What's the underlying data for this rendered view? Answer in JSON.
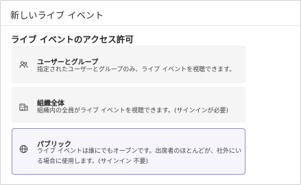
{
  "header": {
    "title": "新しいライブ イベント"
  },
  "section": {
    "title": "ライブ イベントのアクセス許可"
  },
  "options": [
    {
      "title": "ユーザーとグループ",
      "description": "指定されたユーザーとグループのみ、ライブ イベントを視聴できます。",
      "icon": "people-icon",
      "selected": false
    },
    {
      "title": "組織全体",
      "description": "組織内の全員がライブ イベントを視聴できます。(サインインが必要)",
      "icon": "building-icon",
      "selected": false
    },
    {
      "title": "パブリック",
      "description": "ライブ イベントは誰にでもオープンです。出席者のほとんどが、社外にいる場合に使用します。(サインイン 不要)",
      "icon": "globe-icon",
      "selected": true
    }
  ],
  "colors": {
    "selected_border": "#8f8fcf",
    "selected_background": "#f5f5fb",
    "card_background": "#f5f5f5"
  }
}
